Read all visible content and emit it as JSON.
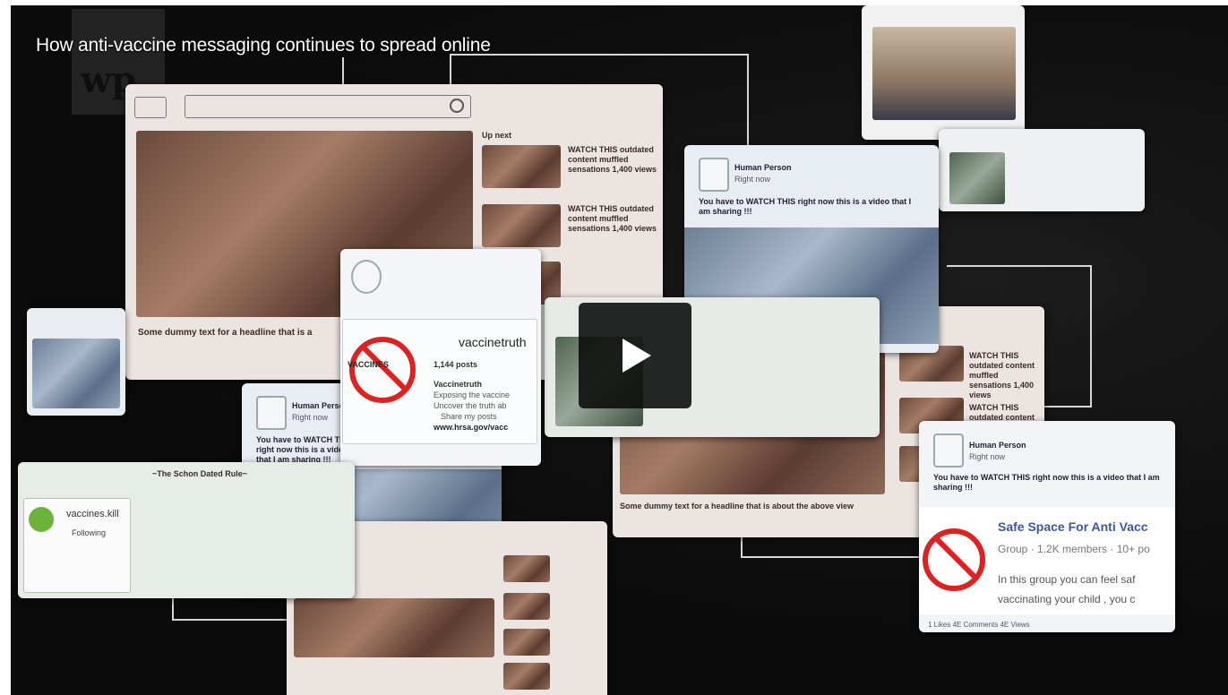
{
  "video": {
    "title": "How anti-vaccine messaging continues to spread online",
    "logo_text": "wp"
  },
  "youtube_mock": {
    "upnext": "Up next",
    "item_text": "WATCH THIS outdated content muffled sensations 1,400 views",
    "headline": "Some dummy text for a headline that is a"
  },
  "post_card": {
    "name": "Human Person",
    "time": "Right now",
    "text": "You have to WATCH THIS right now this is a video that I am sharing !!!"
  },
  "instagram_card": {
    "account": "vaccinetruth",
    "stats": "1,144 posts",
    "name": "Vaccinetruth",
    "bio1": "Exposing the vaccine",
    "bio2": "Uncover the truth ab",
    "bio3": "Share my posts",
    "link": "www.hrsa.gov/vacc",
    "sign": "VACCINES"
  },
  "vaccines_card": {
    "header": "~The Schon Dated Rule~",
    "account": "vaccines.kill",
    "following": "Following",
    "headline_bottom": "Some dummy text for a headline that is about the above view"
  },
  "fb_group": {
    "name": "Safe Space For Anti Vacc",
    "meta": "Group · 1.2K members · 10+ po",
    "desc1": "In this group you can feel saf",
    "desc2": "vaccinating your child , you c",
    "footer": "1 Likes     4E Comments     4E Views"
  },
  "colors": {
    "accent_red": "#d22222",
    "play_bg": "#111111",
    "title_color": "#ffffff"
  },
  "icons": [
    "play-icon",
    "search-icon",
    "no-vaccine-icon",
    "no-syringe-icon"
  ]
}
